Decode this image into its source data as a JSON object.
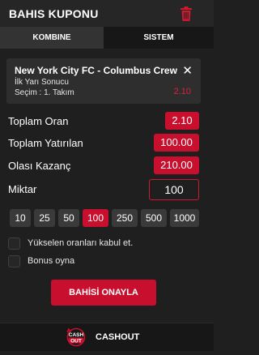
{
  "header": {
    "title": "BAHIS KUPONU",
    "trash_icon": "trash-icon"
  },
  "tabs": [
    {
      "label": "KOMBINE",
      "active": true
    },
    {
      "label": "SISTEM",
      "active": false
    }
  ],
  "bet": {
    "match": "New York City FC - Columbus Crew",
    "market": "İlk Yarı Sonucu",
    "selection": "Seçim : 1. Takım",
    "odds": "2.10"
  },
  "summary": {
    "total_odds_label": "Toplam Oran",
    "total_odds_value": "2.10",
    "total_stake_label": "Toplam Yatırılan",
    "total_stake_value": "100.00",
    "possible_win_label": "Olası Kazanç",
    "possible_win_value": "210.00"
  },
  "stake": {
    "label": "Miktar",
    "value": "100"
  },
  "quick_amounts": [
    "10",
    "25",
    "50",
    "100",
    "250",
    "500",
    "1000"
  ],
  "quick_amount_selected": "100",
  "options": {
    "accept_odds_label": "Yükselen oranları kabul et.",
    "bonus_label": "Bonus oyna"
  },
  "confirm_label": "BAHİSİ ONAYLA",
  "footer": {
    "cashout_label": "CASHOUT",
    "cashout_icon_text_top": "CASH",
    "cashout_icon_text_bottom": "OUT"
  },
  "colors": {
    "accent": "#c8102e",
    "background": "#1f1f1f",
    "panel": "#2e2e2e"
  }
}
